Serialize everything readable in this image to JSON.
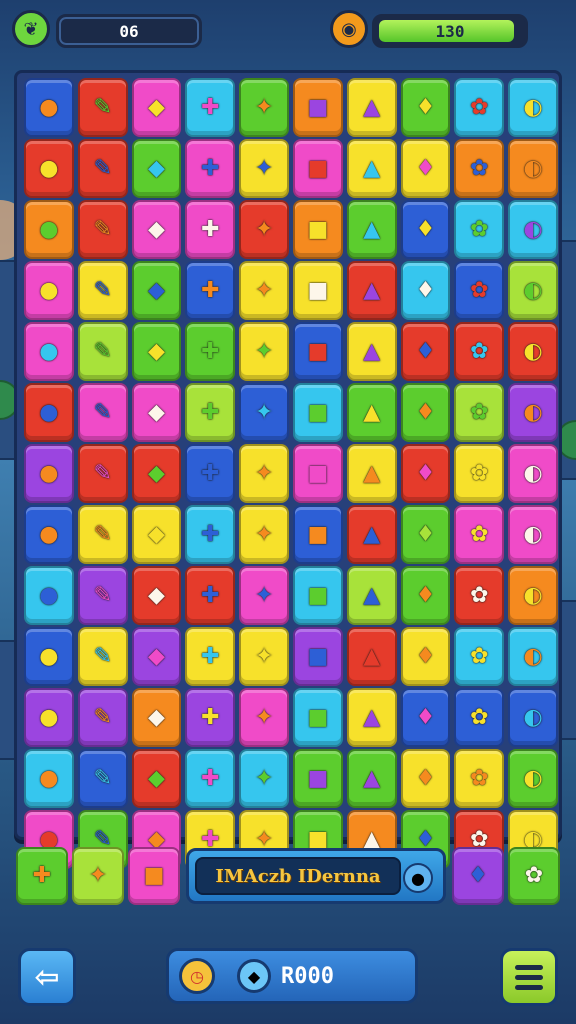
{
  "hud": {
    "score_value": "06",
    "energy_value": "130",
    "energy_fill_fraction": 0.95,
    "left_icon": "leaf-icon",
    "mid_icon": "coin-icon"
  },
  "palette": {
    "red": "#e53b2b",
    "orange": "#f58a1f",
    "yellow": "#f7e12b",
    "green": "#5ccd2e",
    "lime": "#a8e23a",
    "cyan": "#36c6ee",
    "blue": "#2d5fd6",
    "purple": "#9b45e0",
    "pink": "#f04bc8",
    "magenta": "#e23aa8"
  },
  "board": {
    "rows": [
      [
        [
          "blue",
          "orange"
        ],
        [
          "red",
          "green"
        ],
        [
          "pink",
          "yellow"
        ],
        [
          "cyan",
          "pink"
        ],
        [
          "green",
          "orange"
        ],
        [
          "orange",
          "purple"
        ],
        [
          "yellow",
          "purple"
        ],
        [
          "green",
          "yellow"
        ],
        [
          "cyan",
          "red"
        ],
        [
          "cyan",
          "yellow"
        ]
      ],
      [
        [
          "red",
          "yellow"
        ],
        [
          "red",
          "blue"
        ],
        [
          "green",
          "cyan"
        ],
        [
          "pink",
          "blue"
        ],
        [
          "yellow",
          "blue"
        ],
        [
          "pink",
          "red"
        ],
        [
          "yellow",
          "cyan"
        ],
        [
          "yellow",
          "pink"
        ],
        [
          "orange",
          "blue"
        ],
        [
          "orange",
          "orange"
        ]
      ],
      [
        [
          "orange",
          "green"
        ],
        [
          "red",
          "orange"
        ],
        [
          "pink",
          "white"
        ],
        [
          "pink",
          "white"
        ],
        [
          "red",
          "orange"
        ],
        [
          "orange",
          "yellow"
        ],
        [
          "green",
          "cyan"
        ],
        [
          "blue",
          "yellow"
        ],
        [
          "cyan",
          "green"
        ],
        [
          "cyan",
          "purple"
        ]
      ],
      [
        [
          "pink",
          "yellow"
        ],
        [
          "yellow",
          "blue"
        ],
        [
          "green",
          "blue"
        ],
        [
          "blue",
          "orange"
        ],
        [
          "yellow",
          "orange"
        ],
        [
          "yellow",
          "white"
        ],
        [
          "red",
          "purple"
        ],
        [
          "cyan",
          "white"
        ],
        [
          "blue",
          "red"
        ],
        [
          "lime",
          "green"
        ]
      ],
      [
        [
          "pink",
          "cyan"
        ],
        [
          "lime",
          "green"
        ],
        [
          "green",
          "yellow"
        ],
        [
          "green",
          "green"
        ],
        [
          "yellow",
          "green"
        ],
        [
          "blue",
          "red"
        ],
        [
          "yellow",
          "purple"
        ],
        [
          "red",
          "blue"
        ],
        [
          "red",
          "cyan"
        ],
        [
          "red",
          "yellow"
        ]
      ],
      [
        [
          "red",
          "blue"
        ],
        [
          "pink",
          "blue"
        ],
        [
          "pink",
          "white"
        ],
        [
          "lime",
          "green"
        ],
        [
          "blue",
          "cyan"
        ],
        [
          "cyan",
          "green"
        ],
        [
          "green",
          "yellow"
        ],
        [
          "green",
          "orange"
        ],
        [
          "lime",
          "green"
        ],
        [
          "purple",
          "orange"
        ]
      ],
      [
        [
          "purple",
          "orange"
        ],
        [
          "red",
          "pink"
        ],
        [
          "red",
          "green"
        ],
        [
          "blue",
          "blue"
        ],
        [
          "yellow",
          "orange"
        ],
        [
          "pink",
          "pink"
        ],
        [
          "yellow",
          "orange"
        ],
        [
          "red",
          "pink"
        ],
        [
          "yellow",
          "yellow"
        ],
        [
          "pink",
          "white"
        ]
      ],
      [
        [
          "blue",
          "orange"
        ],
        [
          "yellow",
          "orange"
        ],
        [
          "yellow",
          "yellow"
        ],
        [
          "cyan",
          "blue"
        ],
        [
          "yellow",
          "orange"
        ],
        [
          "blue",
          "orange"
        ],
        [
          "red",
          "blue"
        ],
        [
          "green",
          "lime"
        ],
        [
          "pink",
          "yellow"
        ],
        [
          "pink",
          "white"
        ]
      ],
      [
        [
          "cyan",
          "blue"
        ],
        [
          "purple",
          "pink"
        ],
        [
          "red",
          "white"
        ],
        [
          "red",
          "blue"
        ],
        [
          "pink",
          "blue"
        ],
        [
          "cyan",
          "green"
        ],
        [
          "lime",
          "blue"
        ],
        [
          "green",
          "orange"
        ],
        [
          "red",
          "white"
        ],
        [
          "orange",
          "yellow"
        ]
      ],
      [
        [
          "blue",
          "yellow"
        ],
        [
          "yellow",
          "cyan"
        ],
        [
          "purple",
          "pink"
        ],
        [
          "yellow",
          "cyan"
        ],
        [
          "yellow",
          "yellow"
        ],
        [
          "purple",
          "blue"
        ],
        [
          "red",
          "red"
        ],
        [
          "yellow",
          "orange"
        ],
        [
          "cyan",
          "yellow"
        ],
        [
          "cyan",
          "orange"
        ]
      ],
      [
        [
          "purple",
          "yellow"
        ],
        [
          "purple",
          "orange"
        ],
        [
          "orange",
          "white"
        ],
        [
          "purple",
          "yellow"
        ],
        [
          "pink",
          "orange"
        ],
        [
          "cyan",
          "green"
        ],
        [
          "yellow",
          "purple"
        ],
        [
          "blue",
          "pink"
        ],
        [
          "blue",
          "yellow"
        ],
        [
          "blue",
          "cyan"
        ]
      ],
      [
        [
          "cyan",
          "orange"
        ],
        [
          "blue",
          "cyan"
        ],
        [
          "red",
          "green"
        ],
        [
          "cyan",
          "pink"
        ],
        [
          "cyan",
          "green"
        ],
        [
          "green",
          "purple"
        ],
        [
          "green",
          "purple"
        ],
        [
          "yellow",
          "orange"
        ],
        [
          "yellow",
          "orange"
        ],
        [
          "green",
          "yellow"
        ]
      ],
      [
        [
          "pink",
          "red"
        ],
        [
          "green",
          "blue"
        ],
        [
          "pink",
          "orange"
        ],
        [
          "yellow",
          "pink"
        ],
        [
          "yellow",
          "orange"
        ],
        [
          "green",
          "yellow"
        ],
        [
          "orange",
          "white"
        ],
        [
          "green",
          "blue"
        ],
        [
          "red",
          "white"
        ],
        [
          "yellow",
          "yellow"
        ]
      ]
    ],
    "glyphs": [
      "●",
      "✎",
      "◆",
      "✚",
      "✦",
      "■",
      "▲",
      "♦",
      "✿",
      "◐"
    ]
  },
  "strip": {
    "left_tiles": [
      [
        "green",
        "orange"
      ],
      [
        "lime",
        "orange"
      ],
      [
        "pink",
        "orange"
      ]
    ],
    "banner_text": "IMAczb IDernna",
    "banner_icon": "lollipop-icon",
    "right_tiles": [
      [
        "purple",
        "blue"
      ],
      [
        "green",
        "white"
      ]
    ]
  },
  "bottom": {
    "back_icon": "arrow-left-icon",
    "center_text": "R000",
    "center_icon1": "clock-icon",
    "center_icon2": "gem-icon",
    "menu_icon": "menu-icon"
  }
}
